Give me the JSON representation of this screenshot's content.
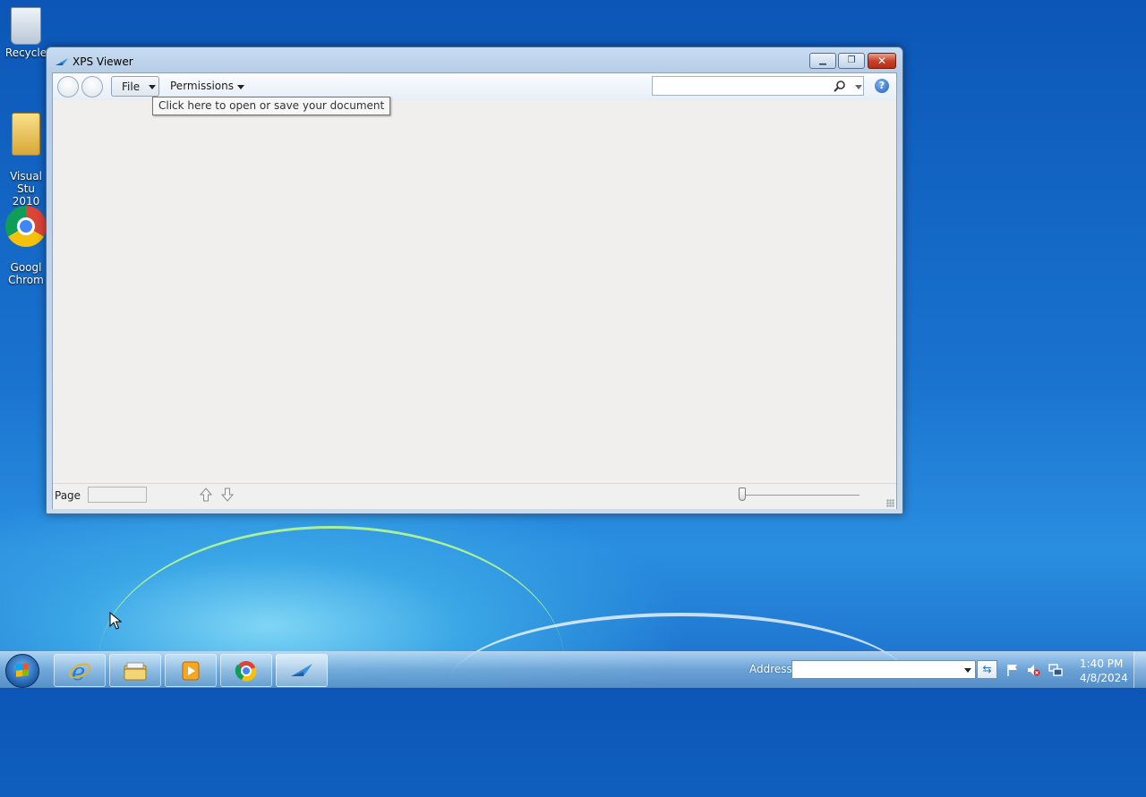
{
  "desktop": {
    "icons": [
      {
        "label": "Recycle",
        "icon": "recycle-bin-icon"
      },
      {
        "label": "Visual Stu\n2010",
        "icon": "folder-icon"
      },
      {
        "label": "Googl\nChrom",
        "icon": "chrome-icon"
      }
    ]
  },
  "window": {
    "title": "XPS Viewer",
    "toolbar": {
      "file_label": "File",
      "permissions_label": "Permissions",
      "search_value": "",
      "help_label": "?"
    },
    "tooltip": "Click here to open or save your document",
    "status": {
      "page_label": "Page",
      "page_value": ""
    }
  },
  "taskbar": {
    "address_label": "Address",
    "address_value": "",
    "clock_time": "1:40 PM",
    "clock_date": "4/8/2024",
    "pinned": [
      "internet-explorer",
      "windows-explorer",
      "media-player",
      "google-chrome",
      "xps-viewer"
    ]
  },
  "colors": {
    "desktop_blue": "#1a73cf",
    "close_red": "#c8432a",
    "tooltip_bg": "#f7f7f7"
  }
}
